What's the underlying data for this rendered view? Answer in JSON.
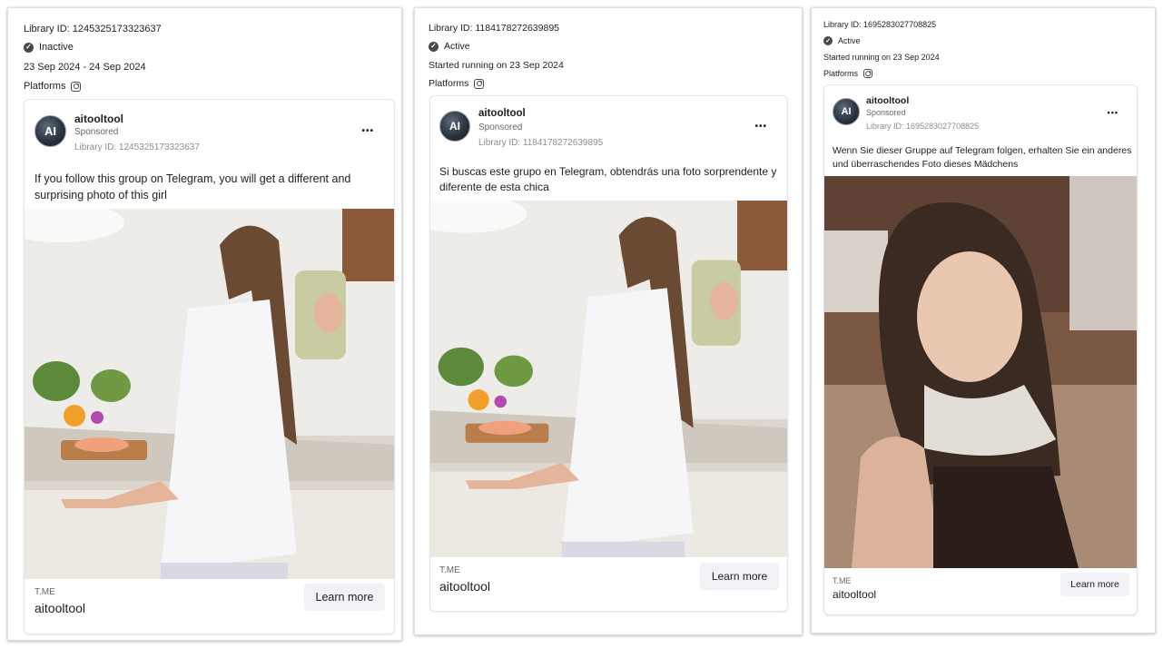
{
  "cards": [
    {
      "library_id": "Library ID: 1245325173323637",
      "status": "Inactive",
      "date_text": "23 Sep 2024 - 24 Sep 2024",
      "platforms_label": "Platforms",
      "ad": {
        "page_name": "aitooltool",
        "sponsored": "Sponsored",
        "library_id": "Library ID: 1245325173323637",
        "avatar_text": "AI",
        "more": "•••",
        "body": "If you follow this group on Telegram, you will get a different and surprising photo of this girl",
        "image": "kitchen-selfie-photo",
        "domain": "T.ME",
        "title": "aitooltool",
        "cta": "Learn more"
      }
    },
    {
      "library_id": "Library ID: 1184178272639895",
      "status": "Active",
      "date_text": "Started running on 23 Sep 2024",
      "platforms_label": "Platforms",
      "ad": {
        "page_name": "aitooltool",
        "sponsored": "Sponsored",
        "library_id": "Library ID: 1184178272639895",
        "avatar_text": "AI",
        "more": "•••",
        "body": "Si buscas este grupo en Telegram, obtendrás una foto sorprendente y diferente de esta chica",
        "image": "kitchen-selfie-photo",
        "domain": "T.ME",
        "title": "aitooltool",
        "cta": "Learn more"
      }
    },
    {
      "library_id": "Library ID: 1695283027708825",
      "status": "Active",
      "date_text": "Started running on 23 Sep 2024",
      "platforms_label": "Platforms",
      "ad": {
        "page_name": "aitooltool",
        "sponsored": "Sponsored",
        "library_id": "Library ID: 1695283027708825",
        "avatar_text": "AI",
        "more": "•••",
        "body": "Wenn Sie dieser Gruppe auf Telegram folgen, erhalten Sie ein anderes und überraschendes Foto dieses Mädchens",
        "image": "bedroom-portrait-photo",
        "domain": "T.ME",
        "title": "aitooltool",
        "cta": "Learn more"
      }
    }
  ],
  "colors": {
    "text": "#1c1e21",
    "muted": "#65676b",
    "button_bg": "#f0f2f5",
    "border": "#dcdfe4"
  }
}
